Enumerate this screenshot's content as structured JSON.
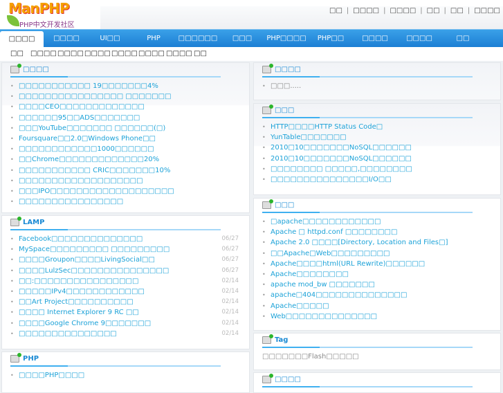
{
  "logo": {
    "text": "ManPHP",
    "tagline": "PHP中文开发社区"
  },
  "top_links": [
    "□□",
    "□□□□",
    "□□□□",
    "□□",
    "□□",
    "□□□□"
  ],
  "nav": [
    "□□□□",
    "□□□□",
    "UI□□",
    "PHP",
    "□□□□□□",
    "□□□",
    "PHP□□□□",
    "PHP□□",
    "□□□□",
    "□□□□",
    "□□"
  ],
  "subnav": [
    "□□",
    "□□□□",
    "□□□□",
    "□□□□",
    "□□□□",
    "□□□□",
    "□□□□",
    "□□"
  ],
  "left": [
    {
      "title": "□□□□",
      "items": [
        {
          "text": "□□□□□□□□□□□ 19□□□□□□□4%"
        },
        {
          "text": "□□□□□□□□□□□□□□□□ □□□□□□□"
        },
        {
          "text": "□□□□CEO□□□□□□□□□□□□□"
        },
        {
          "text": "□□□□□□95□□ADS□□□□□□□"
        },
        {
          "text": "□□□YouTube□□□□□□□ □□□□□□(□)"
        },
        {
          "text": "Foursquare□□2.0□Windows Phone□□"
        },
        {
          "text": "□□□□□□□□□□□□1000□□□□□□"
        },
        {
          "text": "□□Chrome□□□□□□□□□□□□□20%"
        },
        {
          "text": "□□□□□□□□□□□ CRIC□□□□□□□10%"
        },
        {
          "text": "□□□□□□□□□□□□□□□□□□□"
        },
        {
          "text": "□□□IPO□□□□□□□□□□□□□□□□□□□"
        },
        {
          "text": "□□□□□□□□□□□□□□□□"
        }
      ]
    },
    {
      "title": "LAMP",
      "items": [
        {
          "text": "Facebook□□□□□□□□□□□□□□",
          "date": "06/27"
        },
        {
          "text": "MySpace□□□□□□□□□ □□□□□□□□□",
          "date": "06/27"
        },
        {
          "text": "□□□□Groupon□□□□LivingSocial□□",
          "date": "06/27"
        },
        {
          "text": "□□□□LulzSec□□□□□□□□□□□□□□□",
          "date": "06/27"
        },
        {
          "text": "□□:□□□□□□□□□□□□□□□□",
          "date": "02/14"
        },
        {
          "text": "□□□□□IPv4□□□□□□□□□□□□",
          "date": "02/14"
        },
        {
          "text": "□□Art Project□□□□□□□□□□",
          "date": "02/14"
        },
        {
          "text": "□□□□ Internet Explorer 9 RC □□",
          "date": "02/14"
        },
        {
          "text": "□□□□Google Chrome 9□□□□□□□",
          "date": "02/14"
        },
        {
          "text": "□□□□□□□□□□□□□□□",
          "date": "02/14"
        }
      ]
    },
    {
      "title": "PHP",
      "items": [
        {
          "text": "□□□□PHP□□□□"
        }
      ]
    }
  ],
  "right": [
    {
      "title": "□□□□",
      "items": [
        {
          "text": "□□□....."
        }
      ]
    },
    {
      "title": "□□□",
      "items": [
        {
          "text": "HTTP□□□□HTTP Status Code□"
        },
        {
          "text": "YunTable□□□□□□□"
        },
        {
          "text": "2010□10□□□□□□□NoSQL□□□□□□"
        },
        {
          "text": "2010□10□□□□□□□NoSQL□□□□□□"
        },
        {
          "text": "□□□□□□□□ □□□□□,□□□□□□□□"
        },
        {
          "text": "□□□□□□□□□□□□□□□I/O□□"
        }
      ]
    },
    {
      "title": "□□□",
      "items": [
        {
          "text": "□apache□□□□□□□□□□□□"
        },
        {
          "text": "Apache □ httpd.conf □□□□□□□□"
        },
        {
          "text": "Apache 2.0 □□□□[Directory, Location and Files□]"
        },
        {
          "text": "□□Apache□Web□□□□□□□□□"
        },
        {
          "text": "Apache□□□□html(URL Rewrite)□□□□□□"
        },
        {
          "text": "Apache□□□□□□□□"
        },
        {
          "text": "apache mod_bw □□□□□□□"
        },
        {
          "text": "apache□404□□□□□□□□□□□□□□"
        },
        {
          "text": "Apache□□□□□"
        },
        {
          "text": "Web□□□□□□□□□□□□□□"
        }
      ]
    },
    {
      "title": "Tag",
      "text": "□□□□□□□Flash□□□□□"
    },
    {
      "title": "□□□□"
    }
  ]
}
